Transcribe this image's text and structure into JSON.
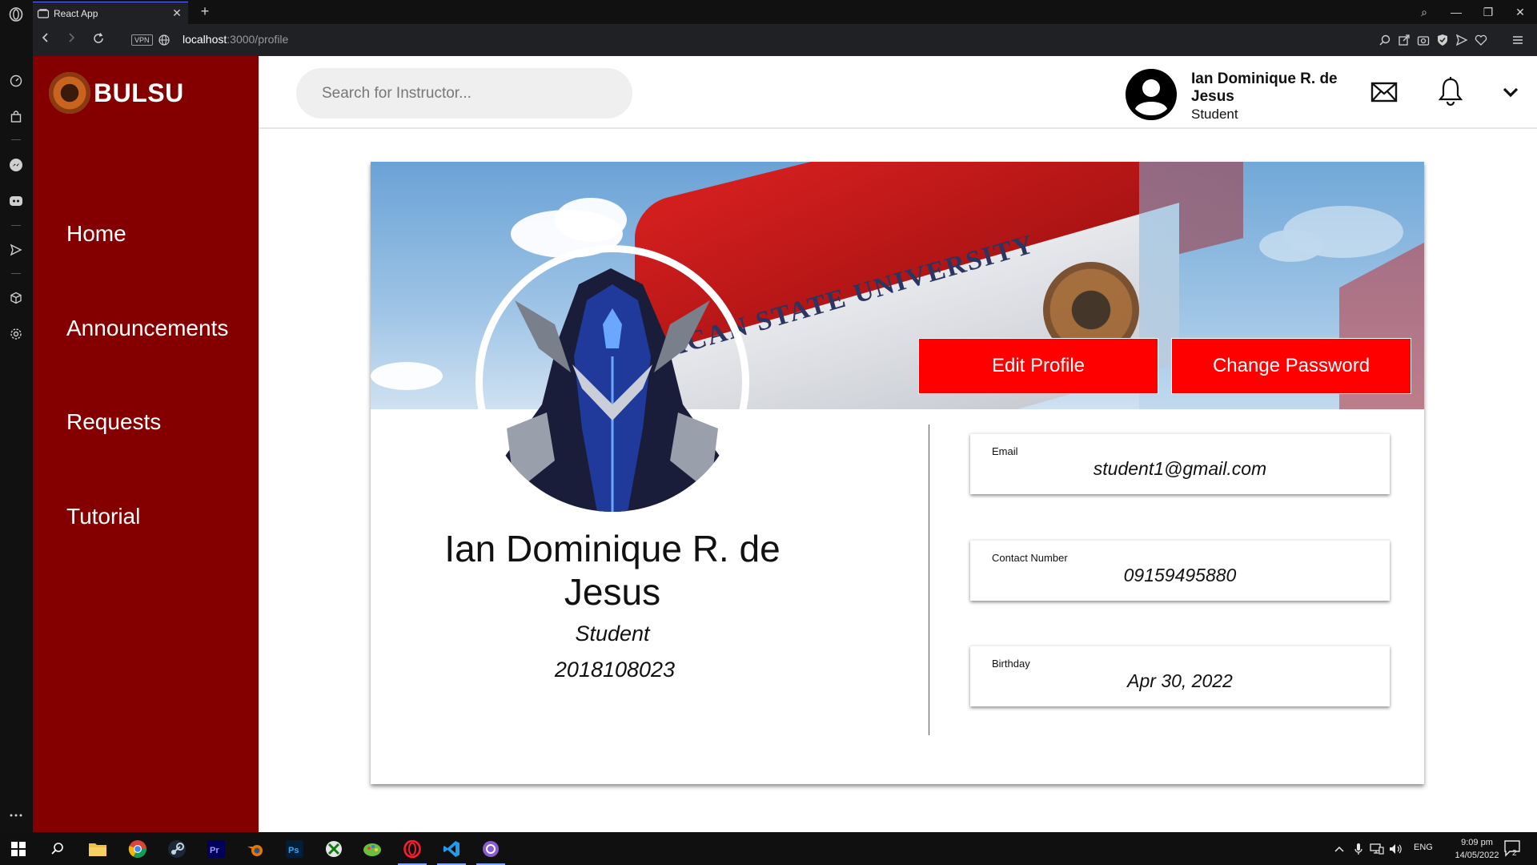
{
  "browser": {
    "tab_title": "React App",
    "tab_close": "✕",
    "new_tab": "+",
    "vpn_label": "VPN",
    "url_host": "localhost",
    "url_path": ":3000/profile",
    "window_controls": {
      "search": "⌕",
      "minimize": "—",
      "restore": "❐",
      "close": "✕"
    }
  },
  "brand": {
    "name": "BULSU"
  },
  "sidebar": {
    "items": [
      {
        "label": "Home"
      },
      {
        "label": "Announcements"
      },
      {
        "label": "Requests"
      },
      {
        "label": "Tutorial"
      }
    ]
  },
  "header": {
    "search_placeholder": "Search for Instructor...",
    "user_name": "Ian Dominique R. de Jesus",
    "user_role": "Student"
  },
  "profile": {
    "edit_label": "Edit Profile",
    "change_password_label": "Change Password",
    "cover_text": "ACAN STATE UNIVERSITY",
    "name": "Ian Dominique R. de Jesus",
    "role": "Student",
    "student_id": "2018108023",
    "email_label": "Email",
    "email_value": "student1@gmail.com",
    "contact_label": "Contact Number",
    "contact_value": "09159495880",
    "birthday_label": "Birthday",
    "birthday_value": "Apr 30, 2022"
  },
  "taskbar": {
    "lang": "ENG",
    "time": "9:09 pm",
    "date": "14/05/2022",
    "notifications": "2"
  },
  "colors": {
    "sidebar_bg": "#840000",
    "button_bg": "#ff0000",
    "browser_bg": "#111111"
  }
}
